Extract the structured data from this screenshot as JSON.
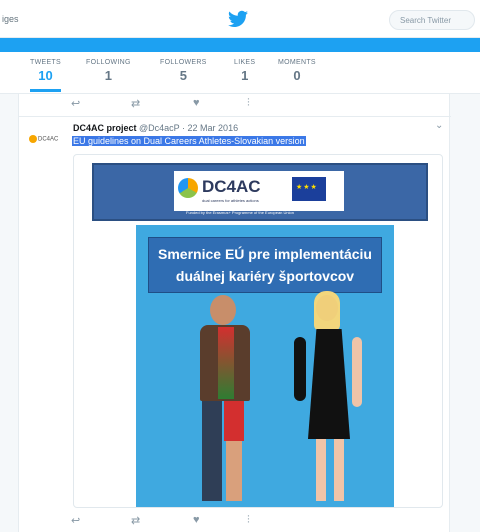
{
  "topbar": {
    "nav_fragment": "iges",
    "search_placeholder": "Search Twitter",
    "brand_color": "#1da1f2"
  },
  "stats": [
    {
      "label": "TWEETS",
      "value": "10"
    },
    {
      "label": "FOLLOWING",
      "value": "1"
    },
    {
      "label": "FOLLOWERS",
      "value": "5"
    },
    {
      "label": "LIKES",
      "value": "1"
    },
    {
      "label": "MOMENTS",
      "value": "0"
    }
  ],
  "actions": {
    "reply_icon": "reply-icon",
    "retweet_icon": "retweet-icon",
    "like_icon": "heart-icon",
    "analytics_icon": "analytics-icon"
  },
  "tweet": {
    "name": "DC4AC project",
    "handle": "@Dc4acP",
    "date": "· 22 Mar 2016",
    "text": "EU guidelines on Dual Careers Athletes-Slovakian version",
    "avatar_label": "DC4AC",
    "image": {
      "logo_text": "DC4AC",
      "logo_sub": "dual careers for athletes actions",
      "funding_line": "Funded by the Erasmus+ Programme of the European Union",
      "poster_title": "Smernice EÚ pre implementáciu duálnej kariéry športovcov"
    }
  }
}
